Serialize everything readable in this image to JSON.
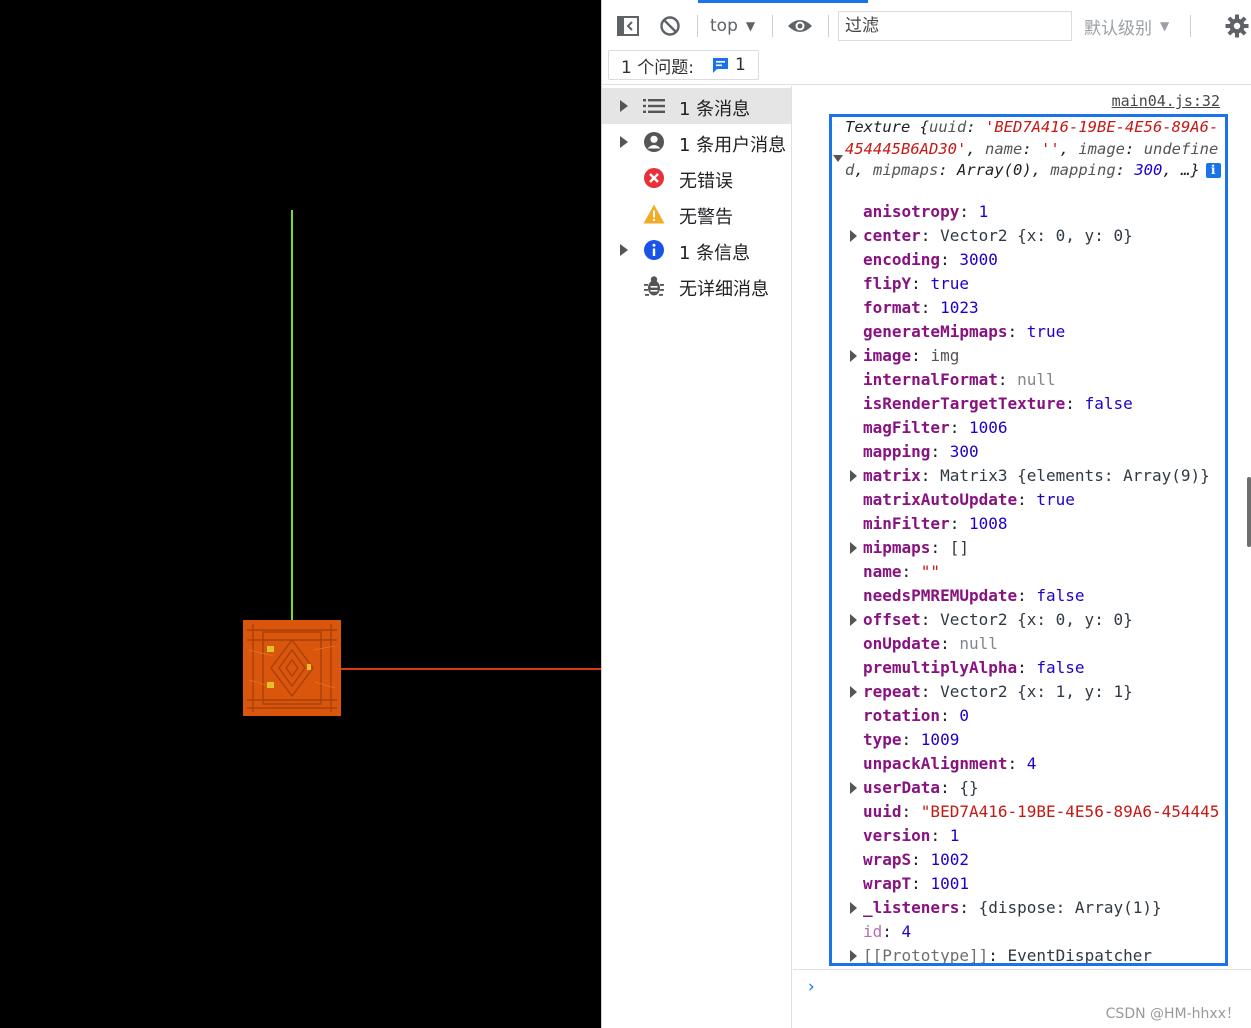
{
  "toolbar": {
    "context": "top",
    "filter_placeholder": "过滤",
    "levels": "默认级别"
  },
  "issues": {
    "label": "1 个问题:",
    "count": "1"
  },
  "sidebar": {
    "items": [
      {
        "label": "1 条消息",
        "icon": "list-icon",
        "expandable": true,
        "selected": true
      },
      {
        "label": "1 条用户消息",
        "icon": "user-icon",
        "expandable": true,
        "selected": false
      },
      {
        "label": "无错误",
        "icon": "error-icon",
        "expandable": false,
        "selected": false
      },
      {
        "label": "无警告",
        "icon": "warning-icon",
        "expandable": false,
        "selected": false
      },
      {
        "label": "1 条信息",
        "icon": "info-icon",
        "expandable": true,
        "selected": false
      },
      {
        "label": "无详细消息",
        "icon": "bug-icon",
        "expandable": false,
        "selected": false
      }
    ]
  },
  "console": {
    "source_link": "main04.js:32",
    "summary": {
      "class_name": "Texture",
      "uuid": "'BED7A416-19BE-4E56-89A6-454445B6AD30'",
      "name_val": "''",
      "image_val": "undefined",
      "mipmaps_val": "Array(0)",
      "mapping_val": "300",
      "ellipsis": "…}"
    },
    "properties": [
      {
        "key": "anisotropy",
        "value": "1",
        "type": "num",
        "expandable": false
      },
      {
        "key": "center",
        "value": "Vector2 {x: 0, y: 0}",
        "type": "obj",
        "expandable": true
      },
      {
        "key": "encoding",
        "value": "3000",
        "type": "num",
        "expandable": false
      },
      {
        "key": "flipY",
        "value": "true",
        "type": "num",
        "expandable": false
      },
      {
        "key": "format",
        "value": "1023",
        "type": "num",
        "expandable": false
      },
      {
        "key": "generateMipmaps",
        "value": "true",
        "type": "num",
        "expandable": false
      },
      {
        "key": "image",
        "value": "img",
        "type": "light",
        "expandable": true
      },
      {
        "key": "internalFormat",
        "value": "null",
        "type": "null",
        "expandable": false
      },
      {
        "key": "isRenderTargetTexture",
        "value": "false",
        "type": "num",
        "expandable": false
      },
      {
        "key": "magFilter",
        "value": "1006",
        "type": "num",
        "expandable": false
      },
      {
        "key": "mapping",
        "value": "300",
        "type": "num",
        "expandable": false
      },
      {
        "key": "matrix",
        "value": "Matrix3 {elements: Array(9)}",
        "type": "obj",
        "expandable": true
      },
      {
        "key": "matrixAutoUpdate",
        "value": "true",
        "type": "num",
        "expandable": false
      },
      {
        "key": "minFilter",
        "value": "1008",
        "type": "num",
        "expandable": false
      },
      {
        "key": "mipmaps",
        "value": "[]",
        "type": "obj",
        "expandable": true
      },
      {
        "key": "name",
        "value": "\"\"",
        "type": "str",
        "expandable": false
      },
      {
        "key": "needsPMREMUpdate",
        "value": "false",
        "type": "num",
        "expandable": false
      },
      {
        "key": "offset",
        "value": "Vector2 {x: 0, y: 0}",
        "type": "obj",
        "expandable": true
      },
      {
        "key": "onUpdate",
        "value": "null",
        "type": "null",
        "expandable": false
      },
      {
        "key": "premultiplyAlpha",
        "value": "false",
        "type": "num",
        "expandable": false
      },
      {
        "key": "repeat",
        "value": "Vector2 {x: 1, y: 1}",
        "type": "obj",
        "expandable": true
      },
      {
        "key": "rotation",
        "value": "0",
        "type": "num",
        "expandable": false
      },
      {
        "key": "type",
        "value": "1009",
        "type": "num",
        "expandable": false
      },
      {
        "key": "unpackAlignment",
        "value": "4",
        "type": "num",
        "expandable": false
      },
      {
        "key": "userData",
        "value": "{}",
        "type": "obj",
        "expandable": true
      },
      {
        "key": "uuid",
        "value": "\"BED7A416-19BE-4E56-89A6-454445",
        "type": "str",
        "expandable": false
      },
      {
        "key": "version",
        "value": "1",
        "type": "num",
        "expandable": false
      },
      {
        "key": "wrapS",
        "value": "1002",
        "type": "num",
        "expandable": false
      },
      {
        "key": "wrapT",
        "value": "1001",
        "type": "num",
        "expandable": false
      },
      {
        "key": "_listeners",
        "value": "{dispose: Array(1)}",
        "type": "obj",
        "expandable": true
      },
      {
        "key": "id",
        "value": "4",
        "type": "num",
        "expandable": false,
        "style": "dim"
      },
      {
        "key": "[[Prototype]]",
        "value": "EventDispatcher",
        "type": "obj",
        "expandable": true,
        "style": "proto"
      }
    ],
    "prompt": "›"
  },
  "watermark": "CSDN @HM-hhxx！",
  "colors": {
    "accent": "#1a73e8",
    "axis_y": "#7ddc1f",
    "axis_x": "#d83a12",
    "box": "#d9560c"
  }
}
